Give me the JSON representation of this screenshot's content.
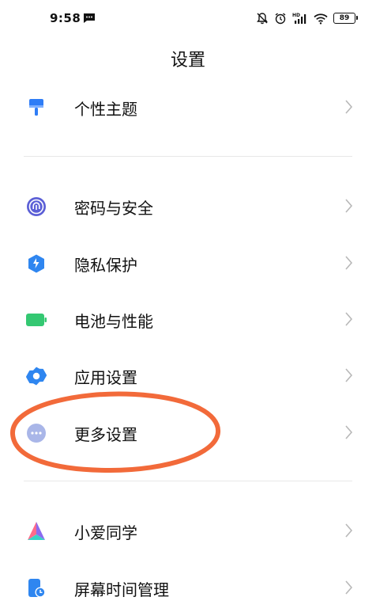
{
  "status_bar": {
    "time": "9:58",
    "battery_level": "89",
    "icons": [
      "message-icon",
      "mute-bell-icon",
      "alarm-icon",
      "hd-signal-icon",
      "wifi-icon",
      "battery-icon"
    ]
  },
  "page": {
    "title": "设置"
  },
  "settings": {
    "theme": {
      "label": "个性主题",
      "icon": "paint-brush-icon"
    },
    "password": {
      "label": "密码与安全",
      "icon": "fingerprint-icon"
    },
    "privacy": {
      "label": "隐私保护",
      "icon": "shield-icon"
    },
    "battery": {
      "label": "电池与性能",
      "icon": "battery-green-icon"
    },
    "apps": {
      "label": "应用设置",
      "icon": "gear-icon"
    },
    "more": {
      "label": "更多设置",
      "icon": "more-dots-icon"
    },
    "xiaoai": {
      "label": "小爱同学",
      "icon": "xiaoai-icon"
    },
    "screen_time": {
      "label": "屏幕时间管理",
      "icon": "screen-time-icon"
    }
  },
  "colors": {
    "theme_blue": "#2f7df6",
    "fingerprint_purple": "#5b5fd6",
    "battery_green": "#34c872",
    "more_grey": "#a9b6e8",
    "annotation_orange": "#f26a3a",
    "chevron": "#b8b8b8"
  }
}
